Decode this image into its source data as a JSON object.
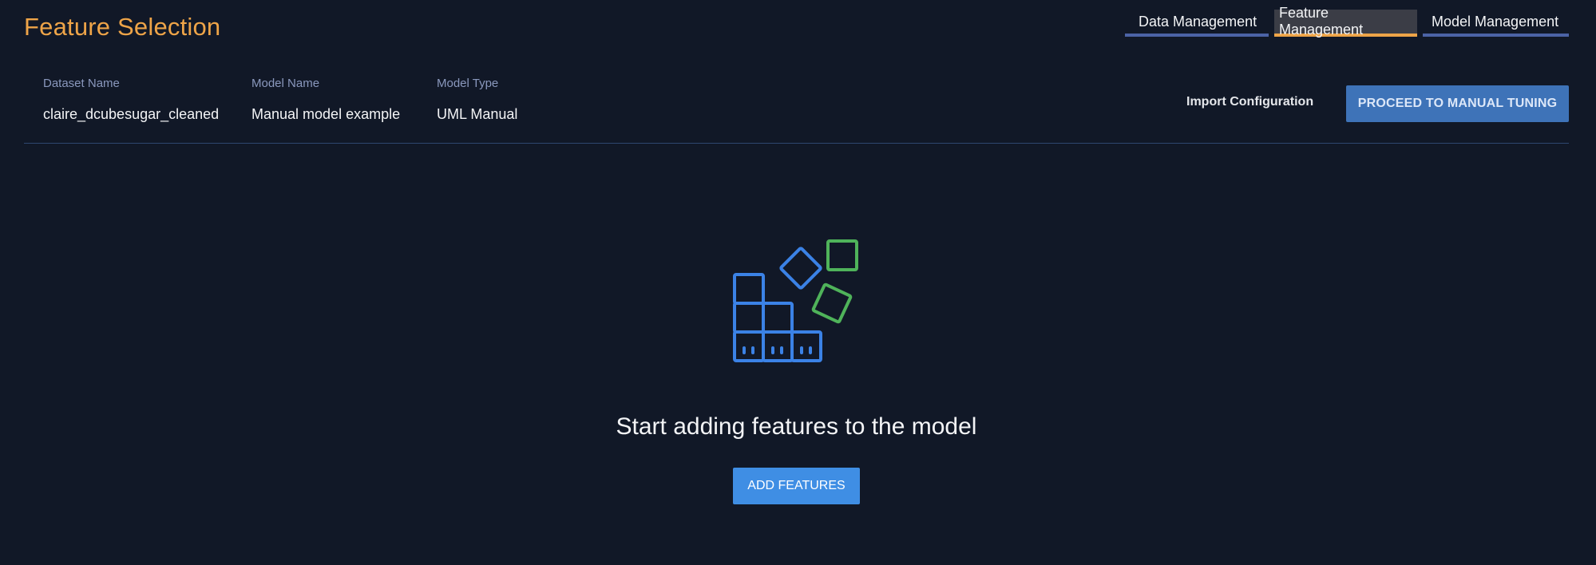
{
  "header": {
    "title": "Feature Selection"
  },
  "nav": {
    "tabs": [
      {
        "label": "Data Management",
        "active": false
      },
      {
        "label": "Feature Management",
        "active": true
      },
      {
        "label": "Model Management",
        "active": false
      }
    ]
  },
  "meta": {
    "dataset": {
      "label": "Dataset Name",
      "value": "claire_dcubesugar_cleaned"
    },
    "model_name": {
      "label": "Model Name",
      "value": "Manual model example"
    },
    "model_type": {
      "label": "Model Type",
      "value": "UML Manual"
    }
  },
  "actions": {
    "import_label": "Import Configuration",
    "proceed_label": "PROCEED TO MANUAL TUNING"
  },
  "empty_state": {
    "icon": "feature-blocks-icon",
    "title": "Start adding features to the model",
    "button_label": "ADD FEATURES"
  },
  "colors": {
    "background": "#111827",
    "accent_orange": "#eea448",
    "accent_blue": "#3f8ee4",
    "icon_blue": "#3b82e6",
    "icon_green": "#4fb35a"
  }
}
